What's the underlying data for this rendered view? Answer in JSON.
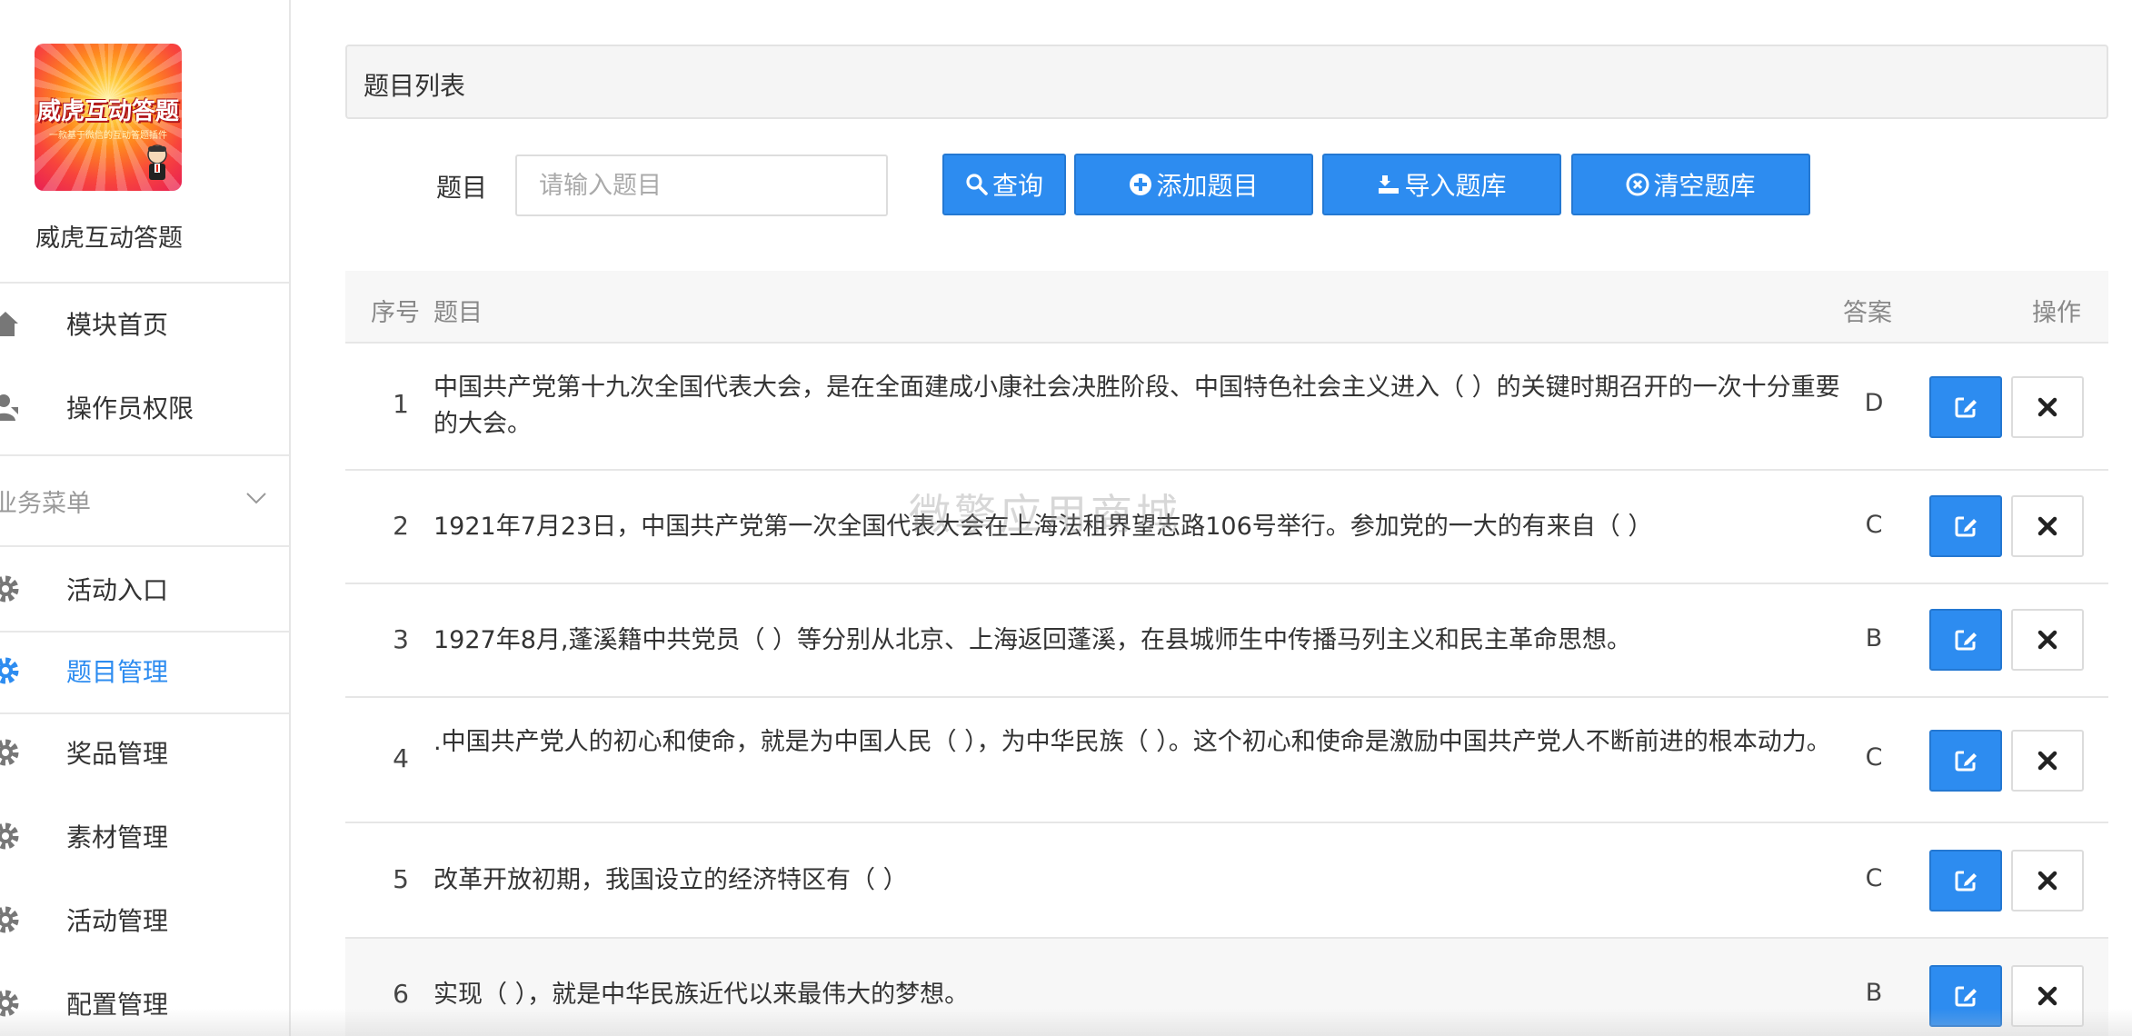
{
  "sidebar": {
    "logo_text": "威虎互动答题",
    "logo_subtext": "一款基于微信的互动答题插件",
    "brand_name": "威虎互动答题",
    "top_items": [
      {
        "label": "模块首页",
        "icon": "home-icon"
      },
      {
        "label": "操作员权限",
        "icon": "user-permission-icon"
      }
    ],
    "group_title": "业务菜单",
    "group_items": [
      {
        "label": "活动入口",
        "icon": "gear-icon"
      },
      {
        "label": "题目管理",
        "icon": "gear-icon",
        "active": true
      },
      {
        "label": "奖品管理",
        "icon": "gear-icon"
      },
      {
        "label": "素材管理",
        "icon": "gear-icon"
      },
      {
        "label": "活动管理",
        "icon": "gear-icon"
      },
      {
        "label": "配置管理",
        "icon": "gear-icon"
      }
    ]
  },
  "main": {
    "panel_title": "题目列表",
    "search": {
      "label": "题目",
      "placeholder": "请输入题目",
      "value": ""
    },
    "buttons": {
      "query": "查询",
      "add": "添加题目",
      "import": "导入题库",
      "clear": "清空题库"
    },
    "table": {
      "headers": {
        "no": "序号",
        "question": "题目",
        "answer": "答案",
        "actions": "操作"
      },
      "rows": [
        {
          "no": "1",
          "question": "中国共产党第十九次全国代表大会，是在全面建成小康社会决胜阶段、中国特色社会主义进入（ ）的关键时期召开的一次十分重要的大会。",
          "answer": "D"
        },
        {
          "no": "2",
          "question": "1921年7月23日，中国共产党第一次全国代表大会在上海法租界望志路106号举行。参加党的一大的有来自（ ）",
          "answer": "C"
        },
        {
          "no": "3",
          "question": "1927年8月,蓬溪籍中共党员（ ）等分别从北京、上海返回蓬溪，在县城师生中传播马列主义和民主革命思想。",
          "answer": "B"
        },
        {
          "no": "4",
          "question": ".中国共产党人的初心和使命，就是为中国人民（ ），为中华民族（ ）。这个初心和使命是激励中国共产党人不断前进的根本动力。",
          "answer": "C"
        },
        {
          "no": "5",
          "question": "改革开放初期，我国设立的经济特区有（ ）",
          "answer": "C"
        },
        {
          "no": "6",
          "question": "实现（ ），就是中华民族近代以来最伟大的梦想。",
          "answer": "B"
        }
      ]
    },
    "watermark": "微擎应用商城"
  },
  "colors": {
    "primary": "#2d8cf0",
    "active_text": "#2d8cf0",
    "header_bg": "#f5f5f5"
  }
}
